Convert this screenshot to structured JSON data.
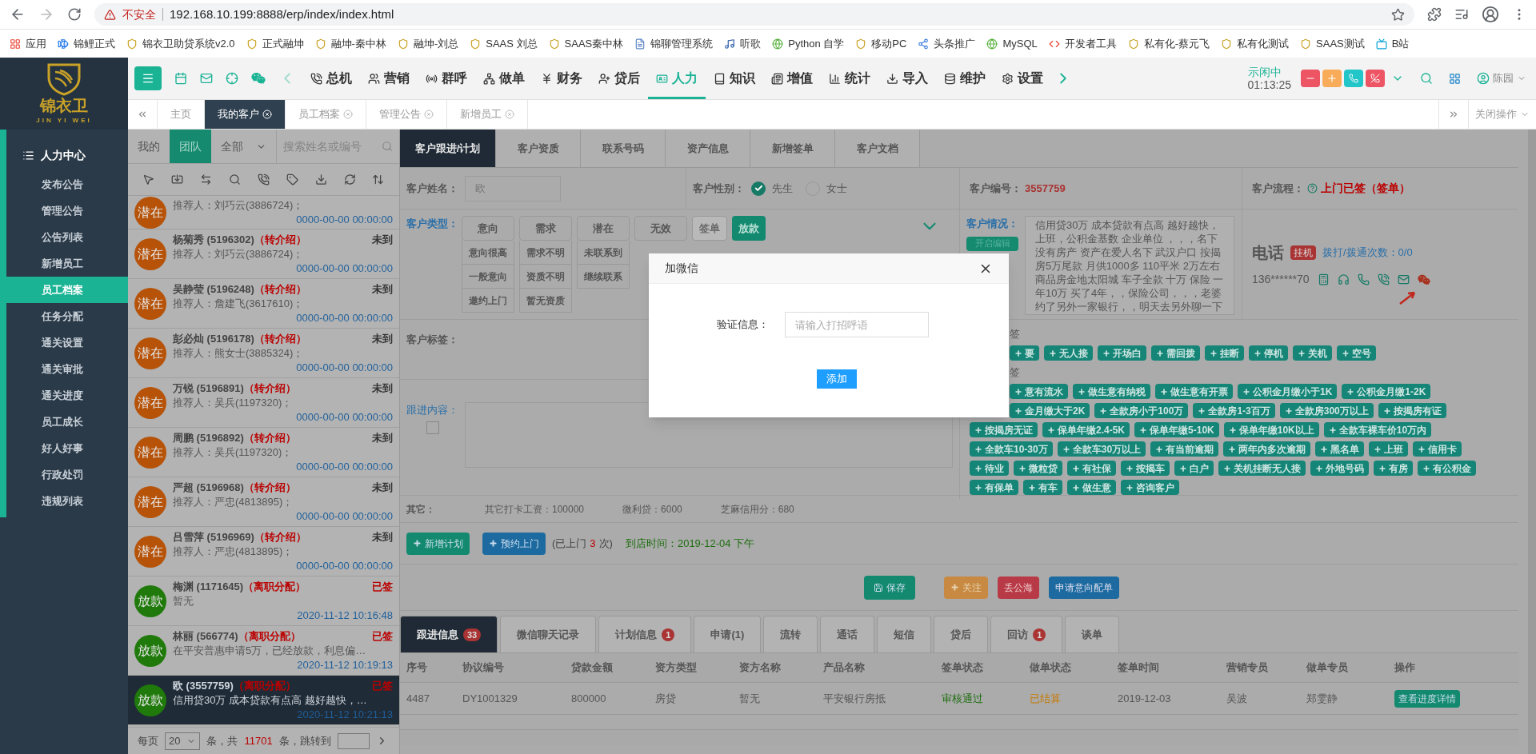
{
  "browser": {
    "security": "不安全",
    "url": "192.168.10.199:8888/erp/index/index.html"
  },
  "bookmarks": [
    "应用",
    "锦鲤正式",
    "锦衣卫助贷系统v2.0",
    "正式融坤",
    "融坤-秦中林",
    "融坤-刘总",
    "SAAS 刘总",
    "SAAS秦中林",
    "锦聊管理系统",
    "听歌",
    "Python 自学",
    "移动PC",
    "头条推广",
    "MySQL",
    "开发者工具",
    "私有化-蔡元飞",
    "私有化测试",
    "SAAS测试",
    "B站"
  ],
  "logo": {
    "title": "锦衣卫",
    "subtitle": "JIN YI WEI"
  },
  "sidebar": {
    "header": "人力中心",
    "items": [
      {
        "label": "发布公告",
        "selected": false
      },
      {
        "label": "管理公告",
        "selected": false
      },
      {
        "label": "公告列表",
        "selected": false
      },
      {
        "label": "新增员工",
        "selected": false
      },
      {
        "label": "员工档案",
        "selected": true
      },
      {
        "label": "任务分配",
        "selected": false
      },
      {
        "label": "通关设置",
        "selected": false
      },
      {
        "label": "通关审批",
        "selected": false
      },
      {
        "label": "通关进度",
        "selected": false
      },
      {
        "label": "员工成长",
        "selected": false
      },
      {
        "label": "好人好事",
        "selected": false
      },
      {
        "label": "行政处罚",
        "selected": false
      },
      {
        "label": "违规列表",
        "selected": false
      }
    ]
  },
  "nav": {
    "items": [
      {
        "label": "总机",
        "selected": false
      },
      {
        "label": "营销",
        "selected": false
      },
      {
        "label": "群呼",
        "selected": false
      },
      {
        "label": "做单",
        "selected": false
      },
      {
        "label": "财务",
        "selected": false
      },
      {
        "label": "贷后",
        "selected": false
      },
      {
        "label": "人力",
        "selected": true
      },
      {
        "label": "知识",
        "selected": false
      },
      {
        "label": "增值",
        "selected": false
      },
      {
        "label": "统计",
        "selected": false
      },
      {
        "label": "导入",
        "selected": false
      },
      {
        "label": "维护",
        "selected": false
      },
      {
        "label": "设置",
        "selected": false
      }
    ],
    "status": "示闲中",
    "timer": "01:13:25",
    "user": "陈园"
  },
  "page_tabs": {
    "items": [
      {
        "label": "主页",
        "selected": false,
        "closable": false
      },
      {
        "label": "我的客户",
        "selected": true,
        "closable": true
      },
      {
        "label": "员工档案",
        "selected": false,
        "closable": true
      },
      {
        "label": "管理公告",
        "selected": false,
        "closable": true
      },
      {
        "label": "新增员工",
        "selected": false,
        "closable": true
      }
    ],
    "close_menu": "关闭操作"
  },
  "customer_list": {
    "filters": [
      {
        "label": "我的",
        "selected": false
      },
      {
        "label": "团队",
        "selected": true
      }
    ],
    "scope": "全部",
    "search_placeholder": "搜索姓名或编号",
    "items": [
      {
        "badge": "潜在",
        "color": "#b65309",
        "note": "推荐人：刘巧云(3886724)；",
        "date": "0000-00-00 00:00:00",
        "selected": false
      },
      {
        "badge": "潜在",
        "color": "#b65309",
        "name": "杨菊秀 (5196302)",
        "tag": "（转介绍）",
        "status": "未到",
        "note": "推荐人：刘巧云(3886724)；",
        "date": "0000-00-00 00:00:00",
        "selected": false
      },
      {
        "badge": "潜在",
        "color": "#b65309",
        "name": "吴静莹 (5196248)",
        "tag": "（转介绍）",
        "status": "未到",
        "note": "推荐人：詹建飞(3617610)；",
        "date": "0000-00-00 00:00:00",
        "selected": false
      },
      {
        "badge": "潜在",
        "color": "#b65309",
        "name": "彭必灿 (5196178)",
        "tag": "（转介绍）",
        "status": "未到",
        "note": "推荐人：熊女士(3885324)；",
        "date": "0000-00-00 00:00:00",
        "selected": false
      },
      {
        "badge": "潜在",
        "color": "#b65309",
        "name": "万锐 (5196891)",
        "tag": "（转介绍）",
        "status": "未到",
        "note": "推荐人：吴兵(1197320)；",
        "date": "0000-00-00 00:00:00",
        "selected": false
      },
      {
        "badge": "潜在",
        "color": "#b65309",
        "name": "周鹏 (5196892)",
        "tag": "（转介绍）",
        "status": "未到",
        "note": "推荐人：吴兵(1197320)；",
        "date": "0000-00-00 00:00:00",
        "selected": false
      },
      {
        "badge": "潜在",
        "color": "#b65309",
        "name": "严超 (5196968)",
        "tag": "（转介绍）",
        "status": "未到",
        "note": "推荐人：严忠(4813895)；",
        "date": "0000-00-00 00:00:00",
        "selected": false
      },
      {
        "badge": "潜在",
        "color": "#b65309",
        "name": "吕雪萍 (5196969)",
        "tag": "（转介绍）",
        "status": "未到",
        "note": "推荐人：严忠(4813895)；",
        "date": "0000-00-00 00:00:00",
        "selected": false
      },
      {
        "badge": "放款",
        "color": "#1f7a0b",
        "name": "梅渊 (1171645)",
        "tag": "（离职分配）",
        "status": "已签",
        "note": "暂无",
        "date": "2020-11-12 10:16:48",
        "selected": false
      },
      {
        "badge": "放款",
        "color": "#1f7a0b",
        "name": "林丽 (566774)",
        "tag": "（离职分配）",
        "status": "已签",
        "note": "在平安普惠申请5万，已经放款，利息偏…",
        "date": "2020-11-12 10:19:13",
        "selected": false
      },
      {
        "badge": "放款",
        "color": "#1f7a0b",
        "name": "欧 (3557759)",
        "tag": "（离职分配）",
        "status": "已签",
        "note": "信用贷30万 成本贷款有点高 越好越快，…",
        "date": "2020-11-12 10:21:13",
        "selected": true
      }
    ],
    "pagination": {
      "per_page_label": "每页",
      "per_page": "20",
      "total_prefix": "条，共",
      "total": "11701",
      "total_suffix": "条，跳转到"
    }
  },
  "detail_tabs": [
    {
      "label": "客户跟进/计划",
      "selected": true
    },
    {
      "label": "客户资质",
      "selected": false
    },
    {
      "label": "联系号码",
      "selected": false
    },
    {
      "label": "资产信息",
      "selected": false
    },
    {
      "label": "新增签单",
      "selected": false
    },
    {
      "label": "客户文档",
      "selected": false
    }
  ],
  "customer": {
    "name_label": "客户姓名：",
    "name": "欧",
    "gender_label": "客户性别：",
    "genders": [
      {
        "label": "先生",
        "selected": true
      },
      {
        "label": "女士",
        "selected": false
      }
    ],
    "id_label": "客户编号：",
    "id": "3557759",
    "flow_label": "客户流程：",
    "flow": "上门已签（签单）",
    "type_label": "客户类型：",
    "type_groups": [
      {
        "title": "意向",
        "options": [
          "意向很高",
          "一般意向",
          "邀约上门"
        ]
      },
      {
        "title": "需求",
        "options": [
          "需求不明",
          "资质不明",
          "暂无资质"
        ]
      },
      {
        "title": "潜在",
        "options": [
          "未联系到",
          "继续联系"
        ]
      },
      {
        "title": "无效"
      }
    ],
    "type_actions": [
      {
        "label": "签单",
        "disabled": true,
        "selected": false
      },
      {
        "label": "放款",
        "disabled": false,
        "selected": true
      }
    ],
    "situation_label": "客户情况：",
    "edit_button": "开启编辑",
    "situation": "信用贷30万 成本贷款有点高 越好越快，上班，公积金基数 企业单位 ，，，名下没有房产 资产在爱人名下 武汉户口 按揭房5万尾款 月供1000多 110平米 2万左右商品房金地太阳城 车子全款 十万 保险 一年10万 买了4年，，保险公司，，，老婆约了另外一家银行，，明天去另外聊一下",
    "phone_title": "电话",
    "hangup": "挂机",
    "dial_count": "拨打/拨通次数：0/0",
    "phone": "136******70",
    "tag_label": "客户标签：",
    "followup_label": "跟进内容：",
    "followup_checked": false,
    "tag_groups": [
      {
        "label": "签",
        "tags": [
          "要",
          "无人接",
          "开场白",
          "需回拨",
          "挂断",
          "停机",
          "关机",
          "空号"
        ]
      },
      {
        "label": "签",
        "tags": [
          "意有流水",
          "做生意有纳税",
          "做生意有开票",
          "公积金月缴小于1K",
          "公积金月缴1-2K",
          "金月缴大于2K",
          "全款房小于100万",
          "全款房1-3百万",
          "全款房300万以上",
          "按揭房有证",
          "按揭房无证",
          "保单年缴2.4-5K",
          "保单年缴5-10K",
          "保单年缴10K以上",
          "全款车裸车价10万内",
          "全款车10-30万",
          "全款车30万以上",
          "有当前逾期",
          "两年内多次逾期",
          "黑名单",
          "上班",
          "信用卡",
          "待业",
          "微粒贷",
          "有社保",
          "按揭车",
          "白户",
          "关机挂断无人接",
          "外地号码",
          "有房",
          "有公积金",
          "有保单",
          "有车",
          "做生意",
          "咨询客户"
        ]
      }
    ],
    "other_label": "其它：",
    "others": [
      "其它打卡工资：100000",
      "微利贷：6000",
      "芝麻信用分：680"
    ],
    "plan_button": "新增计划",
    "visit_button": "预约上门",
    "visit_prefix": "(已上门",
    "visit_count": "3",
    "visit_suffix": "次)",
    "arrival": "到店时间：2019-12-04 下午",
    "actions": [
      {
        "label": "保存",
        "kind": "save"
      },
      {
        "label": "关注",
        "kind": "follow"
      },
      {
        "label": "丢公海",
        "kind": "drop"
      },
      {
        "label": "申请意向配单",
        "kind": "apply"
      }
    ]
  },
  "record_tabs": [
    {
      "label": "跟进信息",
      "count": "33",
      "selected": true
    },
    {
      "label": "微信聊天记录",
      "selected": false
    },
    {
      "label": "计划信息",
      "count": "1",
      "selected": false
    },
    {
      "label": "申请(1)",
      "selected": false
    },
    {
      "label": "流转",
      "selected": false
    },
    {
      "label": "通话",
      "selected": false
    },
    {
      "label": "短信",
      "selected": false
    },
    {
      "label": "贷后",
      "selected": false
    },
    {
      "label": "回访",
      "count": "1",
      "selected": false
    },
    {
      "label": "谈单",
      "selected": false
    }
  ],
  "table": {
    "columns": [
      "序号",
      "协议编号",
      "贷款金额",
      "资方类型",
      "资方名称",
      "产品名称",
      "签单状态",
      "做单状态",
      "签单时间",
      "营销专员",
      "做单专员",
      "操作"
    ],
    "rows": [
      {
        "cells": [
          "4487",
          "DY1001329",
          "800000",
          "房贷",
          "暂无",
          "平安银行房抵",
          "审核通过",
          "已结算",
          "2019-12-03",
          "吴波",
          "郑雯静"
        ],
        "action": "查看进度详情"
      }
    ]
  },
  "dialog": {
    "title": "加微信",
    "field_label": "验证信息：",
    "placeholder": "请输入打招呼语",
    "button": "添加"
  }
}
